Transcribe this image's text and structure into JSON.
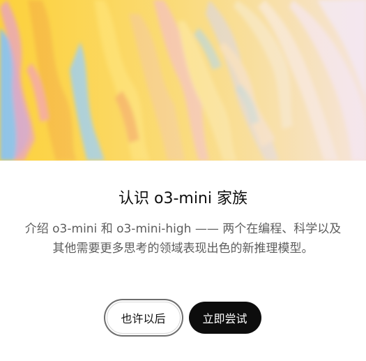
{
  "dialog": {
    "hero_image": "abstract-yellow-paint-strokes",
    "title": "认识 o3-mini 家族",
    "description": "介绍 o3-mini 和 o3-mini-high —— 两个在编程、科学以及其他需要更多思考的领域表现出色的新推理模型。",
    "later_label": "也许以后",
    "try_label": "立即尝试"
  },
  "colors": {
    "primary_button": "#0d0d0d",
    "hero_base": "#fcd13c",
    "text_muted": "#5d5d5d"
  }
}
